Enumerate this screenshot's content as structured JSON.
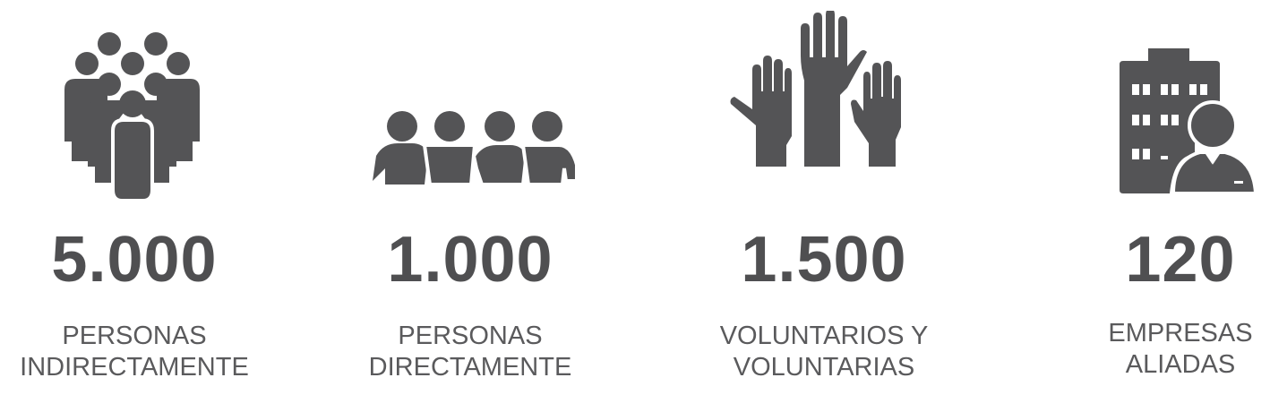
{
  "stats": [
    {
      "icon": "crowd-icon",
      "value": "5.000",
      "label_line1": "PERSONAS",
      "label_line2": "INDIRECTAMENTE"
    },
    {
      "icon": "group-of-four-people-icon",
      "value": "1.000",
      "label_line1": "PERSONAS",
      "label_line2": "DIRECTAMENTE"
    },
    {
      "icon": "raised-hands-icon",
      "value": "1.500",
      "label_line1": "VOLUNTARIOS Y",
      "label_line2": "VOLUNTARIAS"
    },
    {
      "icon": "building-with-businessman-icon",
      "value": "120",
      "label_line1": "EMPRESAS",
      "label_line2": "ALIADAS"
    }
  ],
  "colors": {
    "icon": "#545456",
    "number": "#4f4f51",
    "label": "#5a5a5c",
    "background": "#ffffff"
  }
}
